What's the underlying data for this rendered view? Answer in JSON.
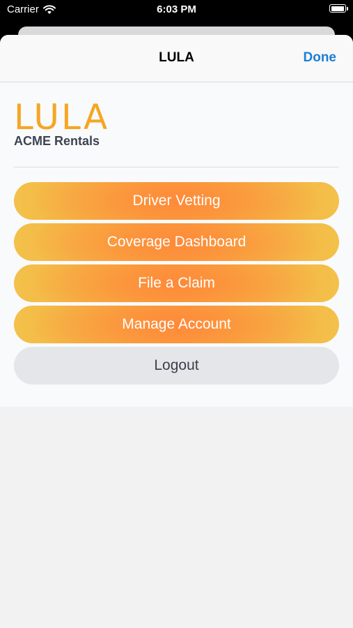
{
  "status_bar": {
    "carrier": "Carrier",
    "time": "6:03 PM",
    "battery_level": 1.0
  },
  "nav": {
    "title": "LULA",
    "done_label": "Done"
  },
  "brand": {
    "logo_text": "LULA",
    "org_name": "ACME Rentals"
  },
  "menu": {
    "items": [
      {
        "label": "Driver Vetting"
      },
      {
        "label": "Coverage Dashboard"
      },
      {
        "label": "File a Claim"
      },
      {
        "label": "Manage Account"
      }
    ],
    "logout_label": "Logout"
  },
  "colors": {
    "accent": "#1b7fd6",
    "brand_orange": "#f5a623",
    "gradient_edge": "#f3c14a",
    "gradient_center": "#ff8a3a"
  }
}
